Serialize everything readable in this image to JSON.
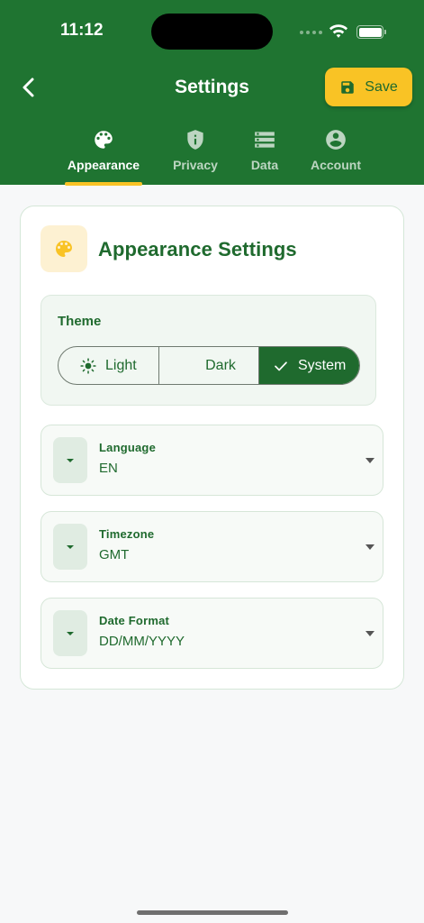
{
  "status_bar": {
    "time": "11:12"
  },
  "header": {
    "title": "Settings",
    "save_label": "Save"
  },
  "tabs": [
    {
      "label": "Appearance",
      "icon": "palette-icon",
      "active": true
    },
    {
      "label": "Privacy",
      "icon": "shield-icon",
      "active": false
    },
    {
      "label": "Data",
      "icon": "storage-icon",
      "active": false
    },
    {
      "label": "Account",
      "icon": "account-circle-icon",
      "active": false
    }
  ],
  "card": {
    "title": "Appearance Settings",
    "theme": {
      "label": "Theme",
      "options": [
        "Light",
        "Dark",
        "System"
      ],
      "selected": "System"
    },
    "dropdowns": [
      {
        "label": "Language",
        "value": "EN"
      },
      {
        "label": "Timezone",
        "value": "GMT"
      },
      {
        "label": "Date Format",
        "value": "DD/MM/YYYY"
      }
    ]
  },
  "colors": {
    "primary": "#1f7431",
    "accent": "#f9c325",
    "text_green": "#1f6a2e",
    "background": "#f7f8f9"
  }
}
